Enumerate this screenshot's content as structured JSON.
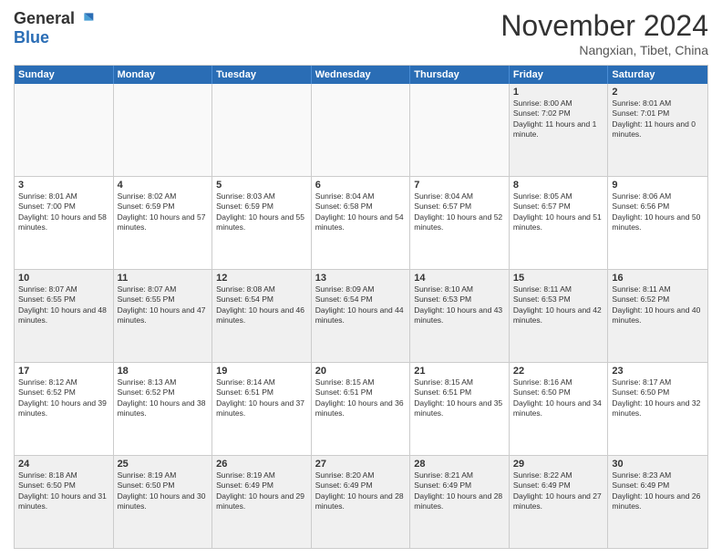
{
  "header": {
    "logo": {
      "general": "General",
      "blue": "Blue"
    },
    "title": "November 2024",
    "location": "Nangxian, Tibet, China"
  },
  "weekdays": [
    "Sunday",
    "Monday",
    "Tuesday",
    "Wednesday",
    "Thursday",
    "Friday",
    "Saturday"
  ],
  "rows": [
    [
      {
        "day": "",
        "empty": true
      },
      {
        "day": "",
        "empty": true
      },
      {
        "day": "",
        "empty": true
      },
      {
        "day": "",
        "empty": true
      },
      {
        "day": "",
        "empty": true
      },
      {
        "day": "1",
        "sunrise": "8:00 AM",
        "sunset": "7:02 PM",
        "daylight": "11 hours and 1 minute."
      },
      {
        "day": "2",
        "sunrise": "8:01 AM",
        "sunset": "7:01 PM",
        "daylight": "11 hours and 0 minutes."
      }
    ],
    [
      {
        "day": "3",
        "sunrise": "8:01 AM",
        "sunset": "7:00 PM",
        "daylight": "10 hours and 58 minutes."
      },
      {
        "day": "4",
        "sunrise": "8:02 AM",
        "sunset": "6:59 PM",
        "daylight": "10 hours and 57 minutes."
      },
      {
        "day": "5",
        "sunrise": "8:03 AM",
        "sunset": "6:59 PM",
        "daylight": "10 hours and 55 minutes."
      },
      {
        "day": "6",
        "sunrise": "8:04 AM",
        "sunset": "6:58 PM",
        "daylight": "10 hours and 54 minutes."
      },
      {
        "day": "7",
        "sunrise": "8:04 AM",
        "sunset": "6:57 PM",
        "daylight": "10 hours and 52 minutes."
      },
      {
        "day": "8",
        "sunrise": "8:05 AM",
        "sunset": "6:57 PM",
        "daylight": "10 hours and 51 minutes."
      },
      {
        "day": "9",
        "sunrise": "8:06 AM",
        "sunset": "6:56 PM",
        "daylight": "10 hours and 50 minutes."
      }
    ],
    [
      {
        "day": "10",
        "sunrise": "8:07 AM",
        "sunset": "6:55 PM",
        "daylight": "10 hours and 48 minutes."
      },
      {
        "day": "11",
        "sunrise": "8:07 AM",
        "sunset": "6:55 PM",
        "daylight": "10 hours and 47 minutes."
      },
      {
        "day": "12",
        "sunrise": "8:08 AM",
        "sunset": "6:54 PM",
        "daylight": "10 hours and 46 minutes."
      },
      {
        "day": "13",
        "sunrise": "8:09 AM",
        "sunset": "6:54 PM",
        "daylight": "10 hours and 44 minutes."
      },
      {
        "day": "14",
        "sunrise": "8:10 AM",
        "sunset": "6:53 PM",
        "daylight": "10 hours and 43 minutes."
      },
      {
        "day": "15",
        "sunrise": "8:11 AM",
        "sunset": "6:53 PM",
        "daylight": "10 hours and 42 minutes."
      },
      {
        "day": "16",
        "sunrise": "8:11 AM",
        "sunset": "6:52 PM",
        "daylight": "10 hours and 40 minutes."
      }
    ],
    [
      {
        "day": "17",
        "sunrise": "8:12 AM",
        "sunset": "6:52 PM",
        "daylight": "10 hours and 39 minutes."
      },
      {
        "day": "18",
        "sunrise": "8:13 AM",
        "sunset": "6:52 PM",
        "daylight": "10 hours and 38 minutes."
      },
      {
        "day": "19",
        "sunrise": "8:14 AM",
        "sunset": "6:51 PM",
        "daylight": "10 hours and 37 minutes."
      },
      {
        "day": "20",
        "sunrise": "8:15 AM",
        "sunset": "6:51 PM",
        "daylight": "10 hours and 36 minutes."
      },
      {
        "day": "21",
        "sunrise": "8:15 AM",
        "sunset": "6:51 PM",
        "daylight": "10 hours and 35 minutes."
      },
      {
        "day": "22",
        "sunrise": "8:16 AM",
        "sunset": "6:50 PM",
        "daylight": "10 hours and 34 minutes."
      },
      {
        "day": "23",
        "sunrise": "8:17 AM",
        "sunset": "6:50 PM",
        "daylight": "10 hours and 32 minutes."
      }
    ],
    [
      {
        "day": "24",
        "sunrise": "8:18 AM",
        "sunset": "6:50 PM",
        "daylight": "10 hours and 31 minutes."
      },
      {
        "day": "25",
        "sunrise": "8:19 AM",
        "sunset": "6:50 PM",
        "daylight": "10 hours and 30 minutes."
      },
      {
        "day": "26",
        "sunrise": "8:19 AM",
        "sunset": "6:49 PM",
        "daylight": "10 hours and 29 minutes."
      },
      {
        "day": "27",
        "sunrise": "8:20 AM",
        "sunset": "6:49 PM",
        "daylight": "10 hours and 28 minutes."
      },
      {
        "day": "28",
        "sunrise": "8:21 AM",
        "sunset": "6:49 PM",
        "daylight": "10 hours and 28 minutes."
      },
      {
        "day": "29",
        "sunrise": "8:22 AM",
        "sunset": "6:49 PM",
        "daylight": "10 hours and 27 minutes."
      },
      {
        "day": "30",
        "sunrise": "8:23 AM",
        "sunset": "6:49 PM",
        "daylight": "10 hours and 26 minutes."
      }
    ]
  ]
}
